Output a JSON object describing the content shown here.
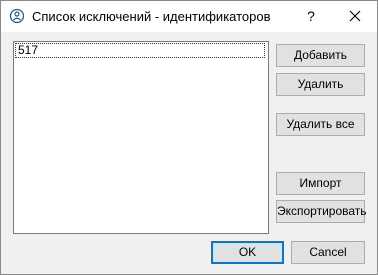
{
  "window": {
    "title": "Список исключений - идентификаторов",
    "help_label": "?"
  },
  "list": {
    "items": [
      "517"
    ]
  },
  "buttons": {
    "add": "Добавить",
    "remove": "Удалить",
    "remove_all": "Удалить все",
    "import": "Импорт",
    "export": "Экспортировать",
    "ok": "OK",
    "cancel": "Cancel"
  },
  "colors": {
    "accent": "#0078d7",
    "dialog_bg": "#f0f0f0",
    "button_bg": "#e1e1e1"
  }
}
